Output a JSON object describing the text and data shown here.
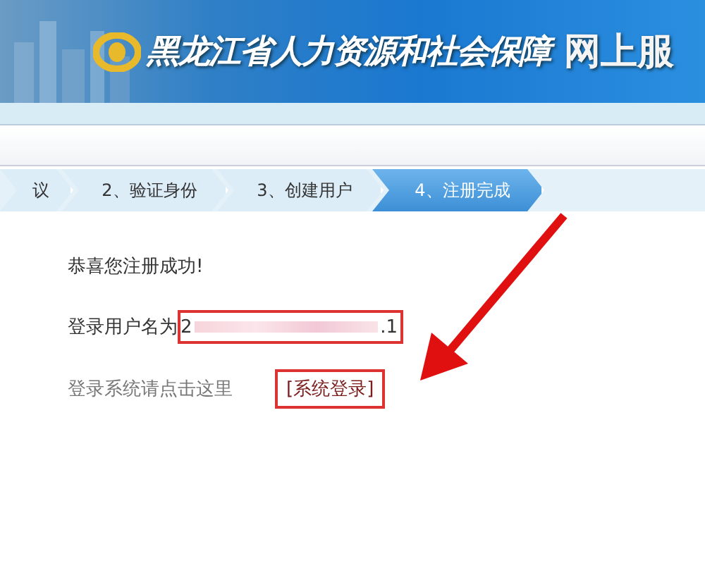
{
  "header": {
    "title": "黑龙江省人力资源和社会保障",
    "subtitle": "网上服"
  },
  "steps": [
    {
      "label": "议",
      "selected": false
    },
    {
      "label": "2、验证身份",
      "selected": false
    },
    {
      "label": "3、创建用户",
      "selected": false
    },
    {
      "label": "4、注册完成",
      "selected": true
    }
  ],
  "content": {
    "success": "恭喜您注册成功!",
    "username_label": "登录用户名为",
    "username_start": "2",
    "username_end": ".1",
    "login_hint": "登录系统请点击这里",
    "login_link": "[系统登录]"
  }
}
